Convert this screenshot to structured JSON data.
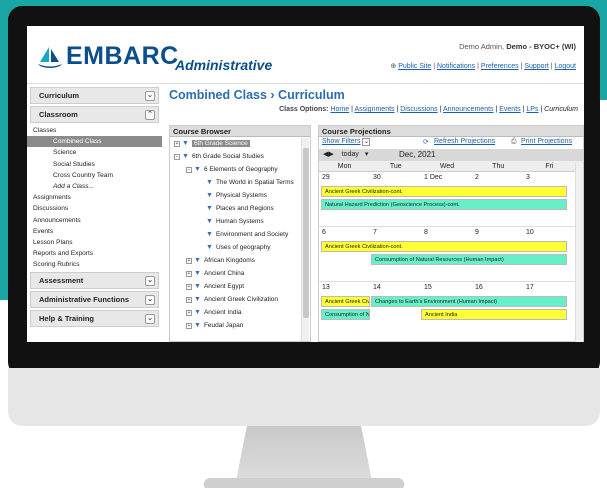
{
  "header": {
    "logo_text": "EMBARC",
    "app_title": "Administrative",
    "user_prefix": "Demo Admin,",
    "user_name": "Demo - BYOC+ (WI)",
    "links": [
      "Public Site",
      "Notifications",
      "Preferences",
      "Support",
      "Logout"
    ]
  },
  "sidebar": {
    "curriculum": "Curriculum",
    "classroom": "Classroom",
    "classes_label": "Classes",
    "classes": [
      "Combined Class",
      "Science",
      "Social Studies",
      "Cross Country Team",
      "Add a Class..."
    ],
    "items": [
      "Assignments",
      "Discussions",
      "Announcements",
      "Events",
      "Lesson Plans",
      "Reports and Exports",
      "Scoring Rubrics"
    ],
    "assessment": "Assessment",
    "admin_functions": "Administrative Functions",
    "help": "Help & Training"
  },
  "main": {
    "breadcrumb": "Combined Class › Curriculum",
    "class_options_label": "Class Options:",
    "class_options": [
      "Home",
      "Assignments",
      "Discussions",
      "Announcements",
      "Events",
      "LPs",
      "Curriculum"
    ]
  },
  "browser": {
    "title": "Course Browser",
    "tree": [
      "6th Grade Science",
      "6th Grade Social Studies",
      "6 Elements of Geography",
      "The World in Spatial Terms",
      "Physical Systems",
      "Places and Regions",
      "Human Systems",
      "Environment and Society",
      "Uses of geography",
      "African Kingdoms",
      "Ancient China",
      "Ancient Egypt",
      "Ancient Greek Civilization",
      "Ancient India",
      "Feudal Japan"
    ]
  },
  "projections": {
    "title": "Course Projections",
    "show_filters": "Show Filters",
    "refresh": "Refresh Projections",
    "print": "Print Projections",
    "today": "today",
    "month": "Dec, 2021",
    "days": [
      "Mon",
      "Tue",
      "Wed",
      "Thu",
      "Fri"
    ],
    "weeks": [
      {
        "dates": [
          "29",
          "30",
          "1 Dec",
          "2",
          "3"
        ],
        "bars": [
          {
            "text": "Ancient Greek Civilization-cont."
          },
          {
            "text": "Natural Hazard Prediction (Geoscience Process)-cont."
          }
        ]
      },
      {
        "dates": [
          "6",
          "7",
          "8",
          "9",
          "10"
        ],
        "bars": [
          {
            "text": "Ancient Greek Civilization-cont."
          },
          {
            "text": "Consumption of Natural Resources (Human Impact)"
          }
        ]
      },
      {
        "dates": [
          "13",
          "14",
          "15",
          "16",
          "17"
        ],
        "bars": [
          {
            "text": "Ancient Greek Civilization-cont."
          },
          {
            "text": "Changes to Earth's Environment (Human Impact)"
          },
          {
            "text": "Consumption of Natural Resources"
          },
          {
            "text": "Ancient India"
          }
        ]
      }
    ]
  },
  "colors": {
    "brand": "#0a4e8c",
    "teal": "#1aa6a4",
    "yellow_bar": "#ffff33",
    "green_bar": "#66f0c8"
  }
}
